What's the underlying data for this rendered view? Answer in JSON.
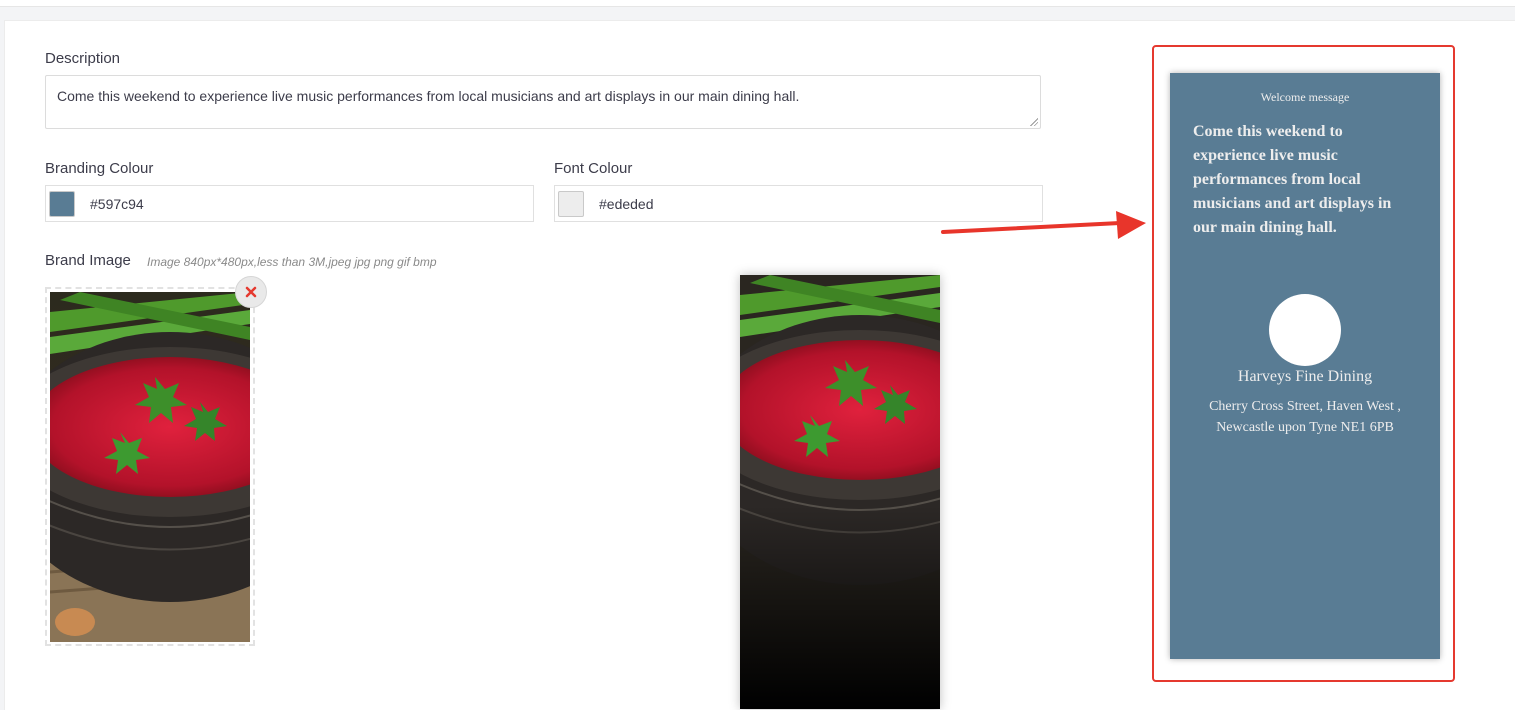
{
  "form": {
    "description_label": "Description",
    "description_value": "Come this weekend to experience live music performances from local musicians and art displays in our main dining hall.",
    "branding_colour_label": "Branding Colour",
    "branding_colour_value": "#597c94",
    "font_colour_label": "Font Colour",
    "font_colour_value": "#ededed",
    "brand_image_label": "Brand Image",
    "brand_image_hint": "Image 840px*480px,less than 3M,jpeg jpg png gif bmp"
  },
  "preview": {
    "welcome_title": "Welcome message",
    "message": "Come this weekend to experience live music performances from local musicians and art displays in our main dining hall.",
    "venue_name": "Harveys Fine Dining",
    "address": "Cherry Cross Street, Haven West ,\nNewcastle upon Tyne    NE1 6PB"
  },
  "colors": {
    "brand": "#597c94",
    "font": "#ededed",
    "highlight": "#e5392f",
    "arrow": "#e8352b"
  },
  "icons": {
    "remove": "close-icon",
    "annotation": "arrow-right-icon"
  }
}
